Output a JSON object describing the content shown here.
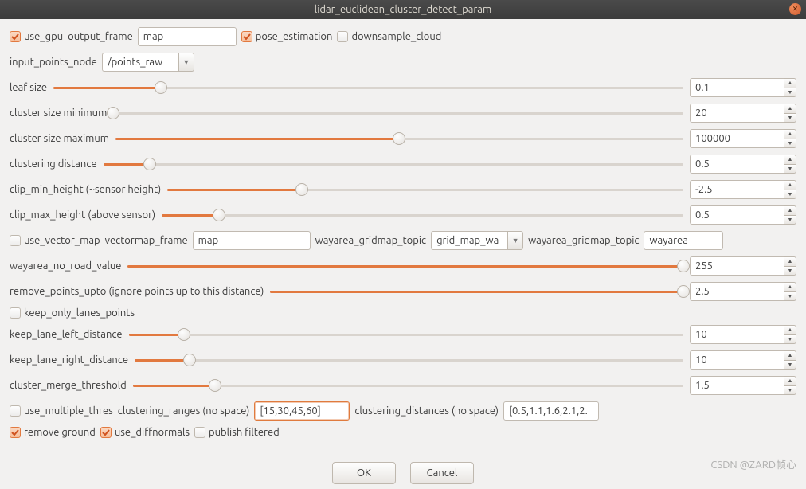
{
  "title": "lidar_euclidean_cluster_detect_param",
  "accent": "#E2793F",
  "top": {
    "use_gpu": {
      "label": "use_gpu",
      "checked": true
    },
    "output_frame": {
      "label": "output_frame",
      "value": "map"
    },
    "pose_estimation": {
      "label": "pose_estimation",
      "checked": true
    },
    "downsample_cloud": {
      "label": "downsample_cloud",
      "checked": false
    }
  },
  "input_points": {
    "label": "input_points_node",
    "value": "/points_raw"
  },
  "sliders": [
    {
      "label": "leaf size",
      "value": "0.1",
      "fill": 17
    },
    {
      "label": "cluster size minimum",
      "value": "20",
      "fill": 0
    },
    {
      "label": "cluster size maximum",
      "value": "100000",
      "fill": 50
    },
    {
      "label": "clustering distance",
      "value": "0.5",
      "fill": 8
    },
    {
      "label": "clip_min_height (~sensor height)",
      "value": "-2.5",
      "fill": 26
    },
    {
      "label": "clip_max_height (above sensor)",
      "value": "0.5",
      "fill": 11
    }
  ],
  "vector_map": {
    "use_vector_map": {
      "label": "use_vector_map",
      "checked": false
    },
    "vectormap_frame": {
      "label": "vectormap_frame",
      "value": "map"
    },
    "wayarea_gridmap_topic": {
      "label": "wayarea_gridmap_topic",
      "value": "grid_map_wa"
    },
    "wayarea_gridmap_topic2": {
      "label": "wayarea_gridmap_topic",
      "value": "wayarea"
    }
  },
  "sliders2": [
    {
      "label": "wayarea_no_road_value",
      "value": "255",
      "fill": 100
    },
    {
      "label": "remove_points_upto (ignore points up to this distance)",
      "value": "2.5",
      "fill": 100
    }
  ],
  "keep_only_lanes": {
    "label": "keep_only_lanes_points",
    "checked": false
  },
  "sliders3": [
    {
      "label": "keep_lane_left_distance",
      "value": "10",
      "fill": 10
    },
    {
      "label": "keep_lane_right_distance",
      "value": "10",
      "fill": 10
    },
    {
      "label": "cluster_merge_threshold",
      "value": "1.5",
      "fill": 15
    }
  ],
  "bottom": {
    "use_multiple_thres": {
      "label": "use_multiple_thres",
      "checked": false
    },
    "clustering_ranges": {
      "label": "clustering_ranges (no space)",
      "value": "[15,30,45,60]"
    },
    "clustering_distances": {
      "label": "clustering_distances (no space)",
      "value": "[0.5,1.1,1.6,2.1,2."
    }
  },
  "bottom2": {
    "remove_ground": {
      "label": "remove ground",
      "checked": true
    },
    "use_diffnormals": {
      "label": "use_diffnormals",
      "checked": true
    },
    "publish_filtered": {
      "label": "publish filtered",
      "checked": false
    }
  },
  "footer": {
    "ok": "OK",
    "cancel": "Cancel"
  },
  "watermark": "CSDN @ZARD帧心"
}
